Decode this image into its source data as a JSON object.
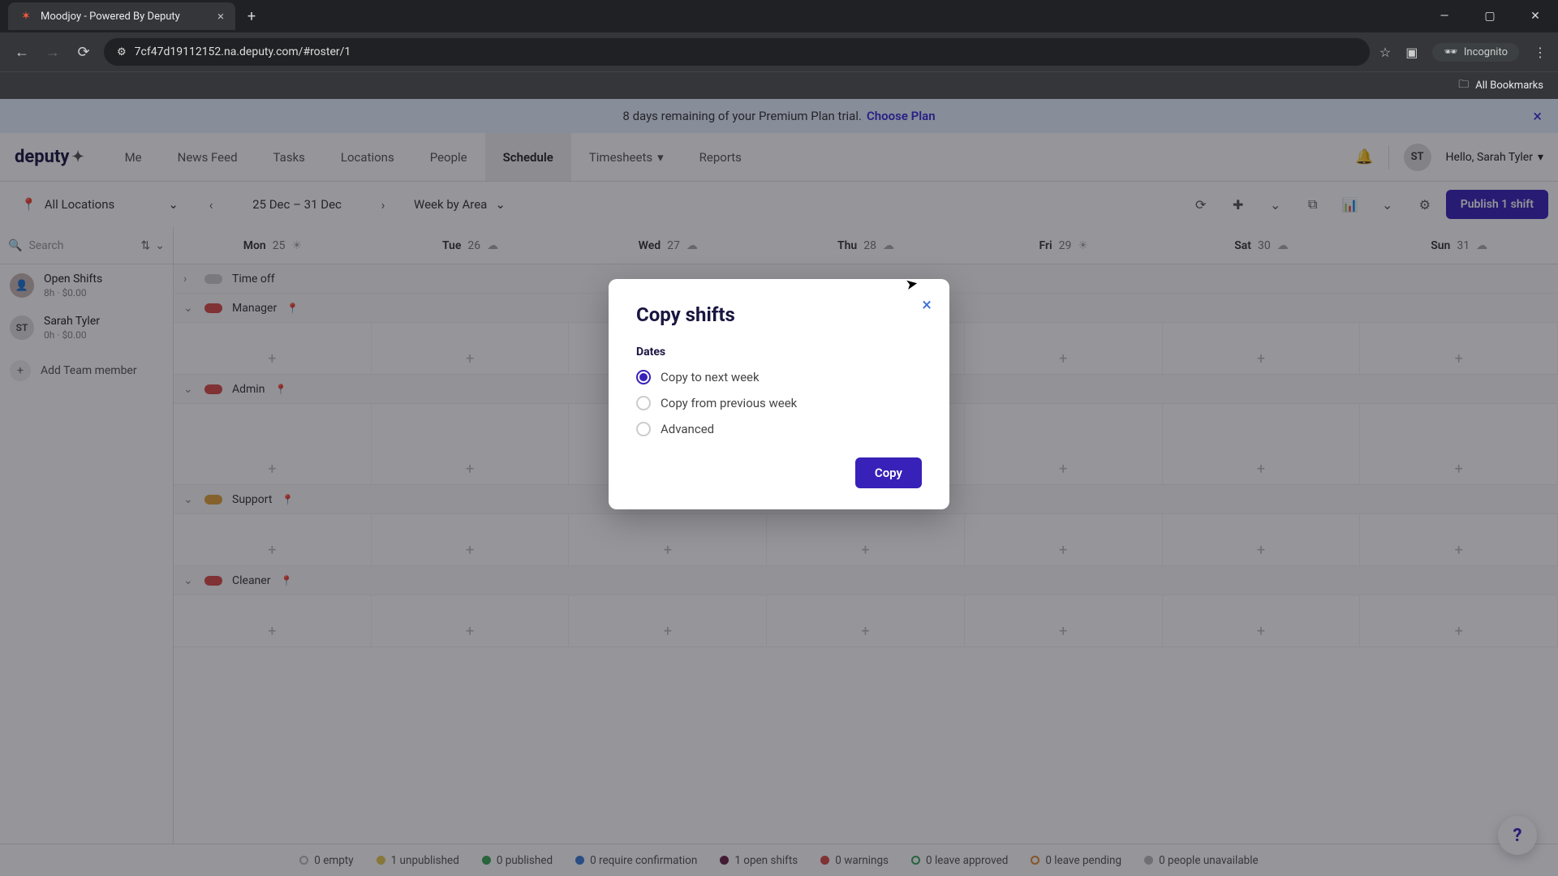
{
  "browser": {
    "tab_title": "Moodjoy - Powered By Deputy",
    "url": "7cf47d19112152.na.deputy.com/#roster/1",
    "incognito": "Incognito",
    "all_bookmarks": "All Bookmarks"
  },
  "banner": {
    "text": "8 days remaining of your Premium Plan trial.",
    "cta": "Choose Plan"
  },
  "logo": "deputy",
  "nav": [
    "Me",
    "News Feed",
    "Tasks",
    "Locations",
    "People",
    "Schedule",
    "Timesheets",
    "Reports"
  ],
  "nav_active": "Schedule",
  "user": {
    "initials": "ST",
    "greeting": "Hello, Sarah Tyler"
  },
  "toolbar": {
    "location": "All Locations",
    "date_range": "25 Dec – 31 Dec",
    "view": "Week by Area",
    "publish": "Publish 1 shift"
  },
  "search": {
    "placeholder": "Search"
  },
  "staff": [
    {
      "name": "Open Shifts",
      "meta": "8h · $0.00",
      "avatar_type": "photo"
    },
    {
      "name": "Sarah Tyler",
      "meta": "0h · $0.00",
      "avatar_type": "st"
    }
  ],
  "add_member": "Add Team member",
  "days": [
    {
      "dow": "Mon",
      "num": "25",
      "weather": "sun"
    },
    {
      "dow": "Tue",
      "num": "26",
      "weather": "cloud"
    },
    {
      "dow": "Wed",
      "num": "27",
      "weather": "cloud"
    },
    {
      "dow": "Thu",
      "num": "28",
      "weather": "cloud"
    },
    {
      "dow": "Fri",
      "num": "29",
      "weather": "sun"
    },
    {
      "dow": "Sat",
      "num": "30",
      "weather": "cloud"
    },
    {
      "dow": "Sun",
      "num": "31",
      "weather": "cloud"
    }
  ],
  "sections": [
    {
      "label": "Time off",
      "color": "grey",
      "collapsed": true
    },
    {
      "label": "Manager",
      "color": "red",
      "collapsed": false
    },
    {
      "label": "Admin",
      "color": "red",
      "collapsed": false
    },
    {
      "label": "Support",
      "color": "orange",
      "collapsed": false
    },
    {
      "label": "Cleaner",
      "color": "red",
      "collapsed": false
    }
  ],
  "footer_stats": [
    {
      "label": "0 empty",
      "dot": ""
    },
    {
      "label": "1 unpublished",
      "dot": "fill-yellow"
    },
    {
      "label": "0 published",
      "dot": "fill-green"
    },
    {
      "label": "0 require confirmation",
      "dot": "fill-blue"
    },
    {
      "label": "1 open shifts",
      "dot": "fill-dark"
    },
    {
      "label": "0 warnings",
      "dot": "fill-red"
    },
    {
      "label": "0 leave approved",
      "dot": "ring-green"
    },
    {
      "label": "0 leave pending",
      "dot": "ring-orange"
    },
    {
      "label": "0 people unavailable",
      "dot": "fill-grey"
    }
  ],
  "modal": {
    "title": "Copy shifts",
    "dates_label": "Dates",
    "options": [
      "Copy to next week",
      "Copy from previous week",
      "Advanced"
    ],
    "selected": 0,
    "button": "Copy"
  }
}
